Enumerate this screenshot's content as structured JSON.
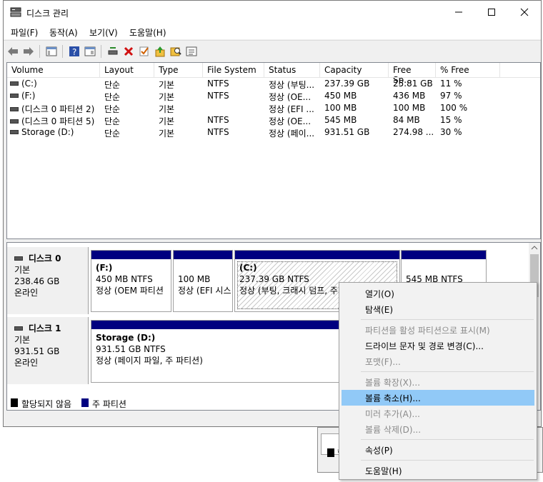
{
  "window": {
    "title": "디스크 관리",
    "menu": [
      "파일(F)",
      "동작(A)",
      "보기(V)",
      "도움말(H)"
    ]
  },
  "columns": [
    "Volume",
    "Layout",
    "Type",
    "File System",
    "Status",
    "Capacity",
    "Free Sp...",
    "% Free"
  ],
  "volumes": [
    {
      "volume": "(C:)",
      "layout": "단순",
      "type": "기본",
      "fs": "NTFS",
      "status": "정상 (부팅...",
      "capacity": "237.39 GB",
      "free": "25.81 GB",
      "pct": "11 %"
    },
    {
      "volume": "(F:)",
      "layout": "단순",
      "type": "기본",
      "fs": "NTFS",
      "status": "정상 (OE...",
      "capacity": "450 MB",
      "free": "436 MB",
      "pct": "97 %"
    },
    {
      "volume": "(디스크 0 파티션 2)",
      "layout": "단순",
      "type": "기본",
      "fs": "",
      "status": "정상 (EFI ...",
      "capacity": "100 MB",
      "free": "100 MB",
      "pct": "100 %"
    },
    {
      "volume": "(디스크 0 파티션 5)",
      "layout": "단순",
      "type": "기본",
      "fs": "NTFS",
      "status": "정상 (OE...",
      "capacity": "545 MB",
      "free": "84 MB",
      "pct": "15 %"
    },
    {
      "volume": "Storage (D:)",
      "layout": "단순",
      "type": "기본",
      "fs": "NTFS",
      "status": "정상 (페이...",
      "capacity": "931.51 GB",
      "free": "274.98 ...",
      "pct": "30 %"
    }
  ],
  "disks": [
    {
      "name": "디스크 0",
      "type": "기본",
      "size": "238.46 GB",
      "state": "온라인",
      "partitions": [
        {
          "label": "(F:)",
          "size": "450 MB NTFS",
          "status": "정상 (OEM 파티션"
        },
        {
          "label": "",
          "size": "100 MB",
          "status": "정상 (EFI 시스"
        },
        {
          "label": "(C:)",
          "size": "237.39 GB NTFS",
          "status": "정상 (부팅, 크래시 덤프, 주"
        },
        {
          "label": "",
          "size": "545 MB NTFS",
          "status": ""
        }
      ]
    },
    {
      "name": "디스크 1",
      "type": "기본",
      "size": "931.51 GB",
      "state": "온라인",
      "partitions": [
        {
          "label": "Storage  (D:)",
          "size": "931.51 GB NTFS",
          "status": "정상 (페이지 파일, 주 파티션)"
        }
      ]
    }
  ],
  "legend": {
    "unallocated": "할당되지 않음",
    "primary": "주 파티션"
  },
  "background_window": {
    "label": "할"
  },
  "context_menu": [
    {
      "label": "열기(O)",
      "state": "enabled"
    },
    {
      "label": "탐색(E)",
      "state": "enabled"
    },
    {
      "label": "파티션을 활성 파티션으로 표시(M)",
      "state": "disabled"
    },
    {
      "label": "드라이브 문자 및 경로 변경(C)...",
      "state": "enabled"
    },
    {
      "label": "포맷(F)...",
      "state": "disabled"
    },
    {
      "label": "볼륨 확장(X)...",
      "state": "disabled"
    },
    {
      "label": "볼륨 축소(H)...",
      "state": "highlighted"
    },
    {
      "label": "미러 추가(A)...",
      "state": "disabled"
    },
    {
      "label": "볼륨 삭제(D)...",
      "state": "disabled"
    },
    {
      "label": "속성(P)",
      "state": "enabled"
    },
    {
      "label": "도움말(H)",
      "state": "enabled"
    }
  ],
  "colors": {
    "primary_partition": "#000080",
    "highlight": "#91c9f7",
    "unallocated": "#000000"
  }
}
